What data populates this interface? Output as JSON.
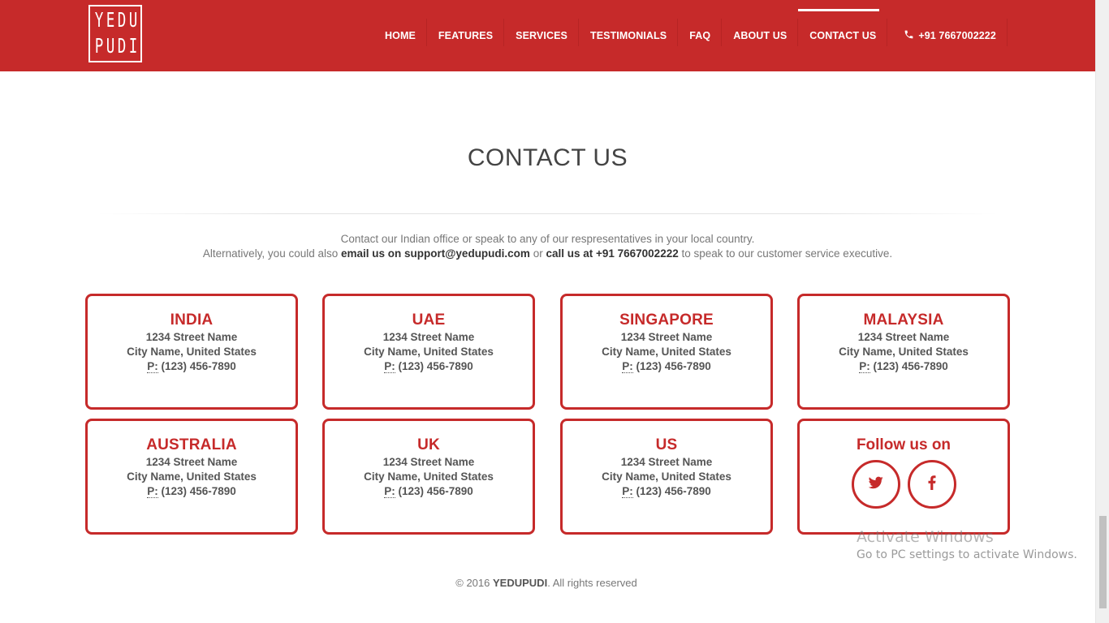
{
  "header": {
    "logo_top_letters": [
      "Y",
      "E",
      "D",
      "U"
    ],
    "logo_bottom_letters": [
      "P",
      "U",
      "D",
      "I"
    ],
    "nav": [
      {
        "label": "HOME"
      },
      {
        "label": "FEATURES"
      },
      {
        "label": "SERVICES"
      },
      {
        "label": "TESTIMONIALS"
      },
      {
        "label": "FAQ"
      },
      {
        "label": "ABOUT US"
      },
      {
        "label": "CONTACT US",
        "active": true
      }
    ],
    "phone_icon": "phone-icon",
    "phone": "+91 7667002222"
  },
  "contact": {
    "title": "CONTACT US",
    "intro_line1": "Contact our Indian office or speak to any of our respresentatives in your local country.",
    "intro_line2_prefix": "Alternatively, you could also ",
    "intro_email": "email us on support@yedupudi.com",
    "intro_mid": " or ",
    "intro_call": "call us at +91 7667002222",
    "intro_suffix": " to speak to our customer service executive.",
    "offices": [
      {
        "name": "INDIA",
        "street": "1234 Street Name",
        "city": "City Name, United States",
        "p_label": "P:",
        "phone": " (123) 456-7890"
      },
      {
        "name": "UAE",
        "street": "1234 Street Name",
        "city": "City Name, United States",
        "p_label": "P:",
        "phone": " (123) 456-7890"
      },
      {
        "name": "SINGAPORE",
        "street": "1234 Street Name",
        "city": "City Name, United States",
        "p_label": "P:",
        "phone": " (123) 456-7890"
      },
      {
        "name": "MALAYSIA",
        "street": "1234 Street Name",
        "city": "City Name, United States",
        "p_label": "P:",
        "phone": " (123) 456-7890"
      },
      {
        "name": "AUSTRALIA",
        "street": "1234 Street Name",
        "city": "City Name, United States",
        "p_label": "P:",
        "phone": " (123) 456-7890"
      },
      {
        "name": "UK",
        "street": "1234 Street Name",
        "city": "City Name, United States",
        "p_label": "P:",
        "phone": " (123) 456-7890"
      },
      {
        "name": "US",
        "street": "1234 Street Name",
        "city": "City Name, United States",
        "p_label": "P:",
        "phone": " (123) 456-7890"
      }
    ],
    "follow": {
      "title": "Follow us on",
      "icons": [
        "twitter-icon",
        "facebook-icon"
      ]
    }
  },
  "footer": {
    "prefix": "© 2016 ",
    "brand": "YEDUPUDI",
    "suffix": ". All rights reserved"
  },
  "watermark": {
    "line1": "Activate Windows",
    "line2": "Go to PC settings to activate Windows."
  },
  "colors": {
    "brand_red": "#c62a2a",
    "text_gray": "#555555"
  }
}
